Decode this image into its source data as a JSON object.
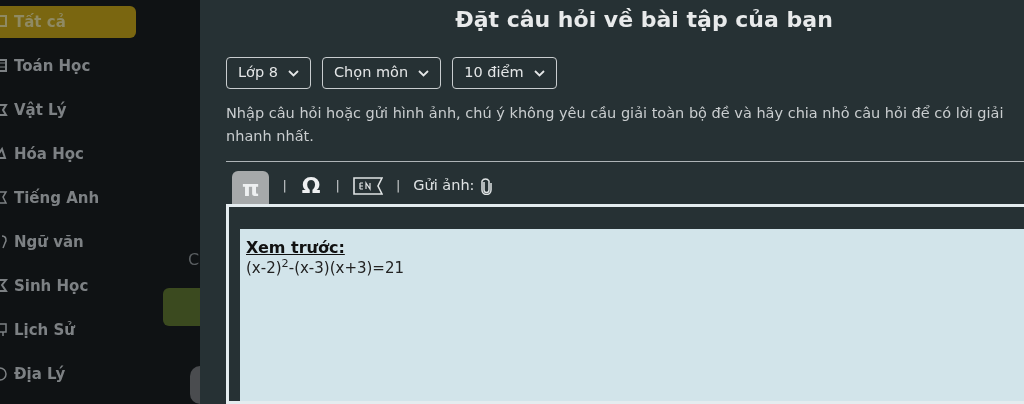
{
  "sidebar": {
    "items": [
      {
        "label": "Tất cả",
        "selected": true
      },
      {
        "label": "Toán Học",
        "selected": false
      },
      {
        "label": "Vật Lý",
        "selected": false
      },
      {
        "label": "Hóa Học",
        "selected": false
      },
      {
        "label": "Tiếng Anh",
        "selected": false
      },
      {
        "label": "Ngữ văn",
        "selected": false
      },
      {
        "label": "Sinh Học",
        "selected": false
      },
      {
        "label": "Lịch Sử",
        "selected": false
      },
      {
        "label": "Địa Lý",
        "selected": false
      }
    ]
  },
  "background_text": "C",
  "dialog": {
    "title": "Đặt câu hỏi về bài tập của bạn",
    "dropdowns": [
      {
        "value": "Lớp 8"
      },
      {
        "value": "Chọn môn"
      },
      {
        "value": "10 điểm"
      }
    ],
    "hint": "Nhập câu hỏi hoặc gửi hình ảnh, chú ý không yêu cầu giải toàn bộ đề và hãy chia nhỏ câu hỏi để có lời giải nhanh nhất.",
    "toolbar": [
      {
        "kind": "pi",
        "label": "π",
        "selected": true
      },
      {
        "kind": "sep",
        "label": "|"
      },
      {
        "kind": "omega",
        "label": "Ω",
        "selected": false
      },
      {
        "kind": "sep",
        "label": "|"
      },
      {
        "kind": "en",
        "selected": false
      },
      {
        "kind": "sep",
        "label": "|"
      },
      {
        "kind": "attach",
        "label": "Gửi ảnh:"
      }
    ],
    "preview": {
      "heading": "Xem trước:",
      "content": "(x-2)$^{2}$-(x-3)(x+3)=21"
    }
  }
}
